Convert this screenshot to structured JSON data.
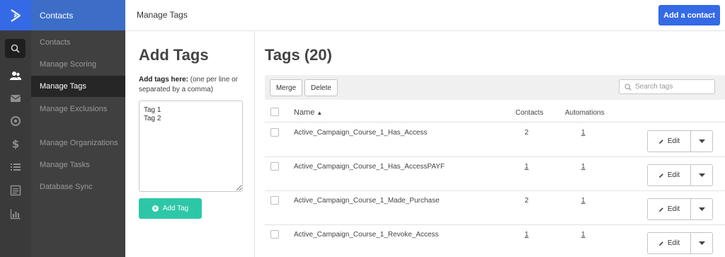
{
  "sidebar": {
    "header": "Contacts",
    "items": [
      {
        "label": "Contacts"
      },
      {
        "label": "Manage Scoring"
      },
      {
        "label": "Manage Tags"
      },
      {
        "label": "Manage Exclusions"
      },
      {
        "label": "Manage Organizations"
      },
      {
        "label": "Manage Tasks"
      },
      {
        "label": "Database Sync"
      }
    ],
    "active_item": "Manage Tags"
  },
  "rail_icons": [
    "logo-icon",
    "search-icon",
    "contacts-icon",
    "mail-icon",
    "target-icon",
    "dollar-icon",
    "list-icon",
    "document-icon",
    "chart-icon"
  ],
  "header": {
    "title": "Manage Tags",
    "add_contact_label": "Add a contact"
  },
  "add_tags": {
    "title": "Add Tags",
    "hint_bold": "Add tags here:",
    "hint_rest": " (one per line or separated by a comma)",
    "textarea_value": "Tag 1\nTag 2",
    "button_label": "Add Tag"
  },
  "tags": {
    "title": "Tags (20)",
    "merge_label": "Merge",
    "delete_label": "Delete",
    "search_placeholder": "Search tags",
    "columns": {
      "name": "Name",
      "contacts": "Contacts",
      "automations": "Automations"
    },
    "sort_indicator": "▲",
    "edit_label": "Edit",
    "rows": [
      {
        "name": "Active_Campaign_Course_1_Has_Access",
        "contacts": "2",
        "automations": "1"
      },
      {
        "name": "Active_Campaign_Course_1_Has_AccessPAYF",
        "contacts": "1",
        "automations": "1"
      },
      {
        "name": "Active_Campaign_Course_1_Made_Purchase",
        "contacts": "2",
        "automations": "1"
      },
      {
        "name": "Active_Campaign_Course_1_Revoke_Access",
        "contacts": "1",
        "automations": "1"
      }
    ]
  },
  "colors": {
    "accent": "#356ae6",
    "sidebar_header": "#3c6ec8",
    "add_button": "#2dc7a8"
  }
}
